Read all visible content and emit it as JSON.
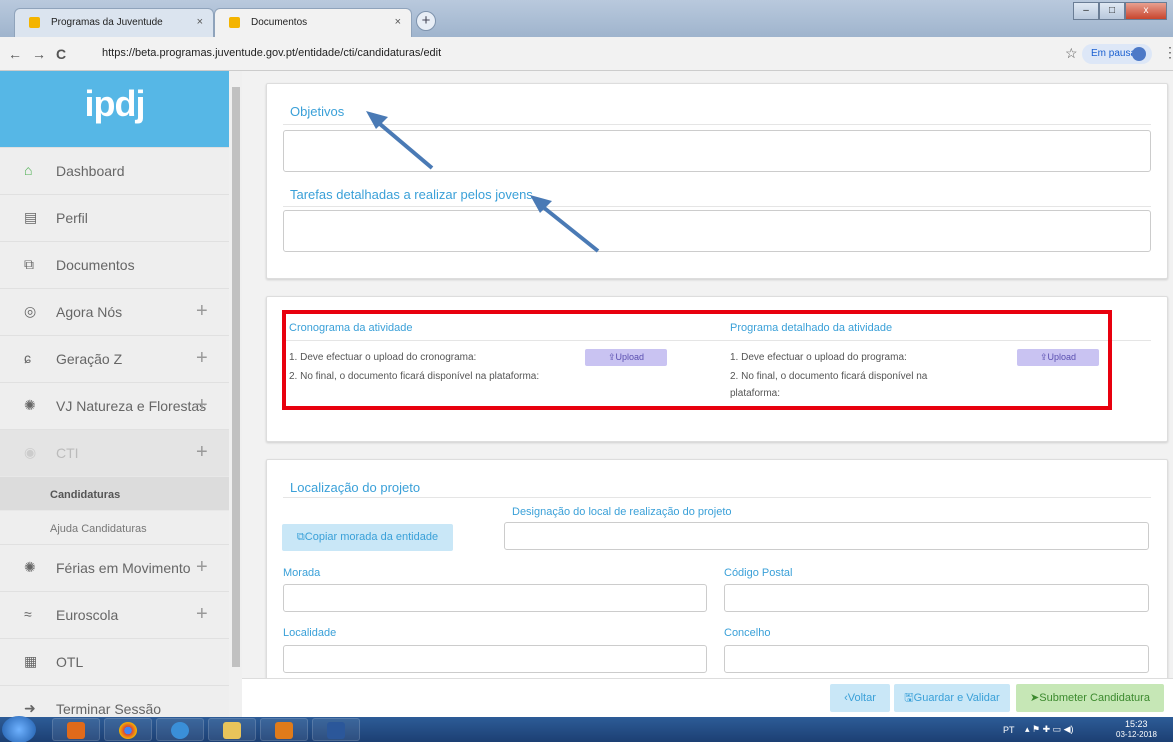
{
  "browser": {
    "tabs": [
      {
        "title": "Programas da Juventude",
        "close": "×"
      },
      {
        "title": "Documentos",
        "close": "×"
      }
    ],
    "new_tab": "+",
    "back": "←",
    "forward": "→",
    "reload": "C",
    "url": "https://beta.programas.juventude.gov.pt/entidade/cti/candidaturas/edit",
    "star": "☆",
    "profile_status": "Em pausa",
    "menu": "⋮",
    "window_buttons": {
      "minimize": "–",
      "maximize": "□",
      "close": "x"
    }
  },
  "sidebar": {
    "logo": "ipdj",
    "items": [
      {
        "label": "Dashboard",
        "icon": "home-icon",
        "glyph": "⌂",
        "plus": ""
      },
      {
        "label": "Perfil",
        "icon": "id-card-icon",
        "glyph": "▤",
        "plus": ""
      },
      {
        "label": "Documentos",
        "icon": "documents-icon",
        "glyph": "⧉",
        "plus": ""
      },
      {
        "label": "Agora Nós",
        "icon": "agora-icon",
        "glyph": "◎",
        "plus": "+"
      },
      {
        "label": "Geração Z",
        "icon": "geracao-icon",
        "glyph": "ɕ",
        "plus": "+"
      },
      {
        "label": "VJ Natureza e Florestas",
        "icon": "nature-icon",
        "glyph": "✺",
        "plus": "+"
      },
      {
        "label": "CTI",
        "icon": "cti-icon",
        "glyph": "◉",
        "plus": "+"
      }
    ],
    "sub_items": [
      {
        "label": "Candidaturas"
      },
      {
        "label": "Ajuda Candidaturas"
      }
    ],
    "items_after": [
      {
        "label": "Férias em Movimento",
        "icon": "ferias-icon",
        "glyph": "✺",
        "plus": "+"
      },
      {
        "label": "Euroscola",
        "icon": "euroscola-icon",
        "glyph": "≈",
        "plus": "+"
      },
      {
        "label": "OTL",
        "icon": "otl-icon",
        "glyph": "▦",
        "plus": ""
      },
      {
        "label": "Terminar Sessão",
        "icon": "logout-icon",
        "glyph": "➜",
        "plus": ""
      }
    ]
  },
  "form": {
    "objetivos_label": "Objetivos",
    "tarefas_label": "Tarefas detalhadas a realizar pelos jovens",
    "cronograma": {
      "title": "Cronograma da atividade",
      "step1": "1. Deve efectuar o upload do cronograma:",
      "step2": "2. No final, o documento ficará disponível na plataforma:",
      "upload": "⇪Upload"
    },
    "programa": {
      "title": "Programa detalhado da atividade",
      "step1": "1. Deve efectuar o upload do programa:",
      "step2a": "2. No final, o documento ficará disponível na",
      "step2b": "plataforma:",
      "upload": "⇪Upload"
    },
    "localizacao": {
      "title": "Localização do projeto",
      "designacao_label": "Designação do local de realização do projeto",
      "copy_button": "⧉Copiar morada da entidade",
      "morada_label": "Morada",
      "codigo_postal_label": "Código Postal",
      "localidade_label": "Localidade",
      "concelho_label": "Concelho"
    }
  },
  "footer": {
    "voltar": "‹Voltar",
    "guardar": "🖫Guardar e Validar",
    "submeter": "Submeter Candidatura"
  },
  "taskbar": {
    "lang": "PT",
    "time": "15:23",
    "date": "03-12-2018"
  },
  "colors": {
    "accent": "#3aa0d8",
    "logo_bg": "#56b7e6",
    "highlight_box": "#e8000e",
    "arrow": "#4a7ab5",
    "submit_bg": "#c6e7b6"
  }
}
